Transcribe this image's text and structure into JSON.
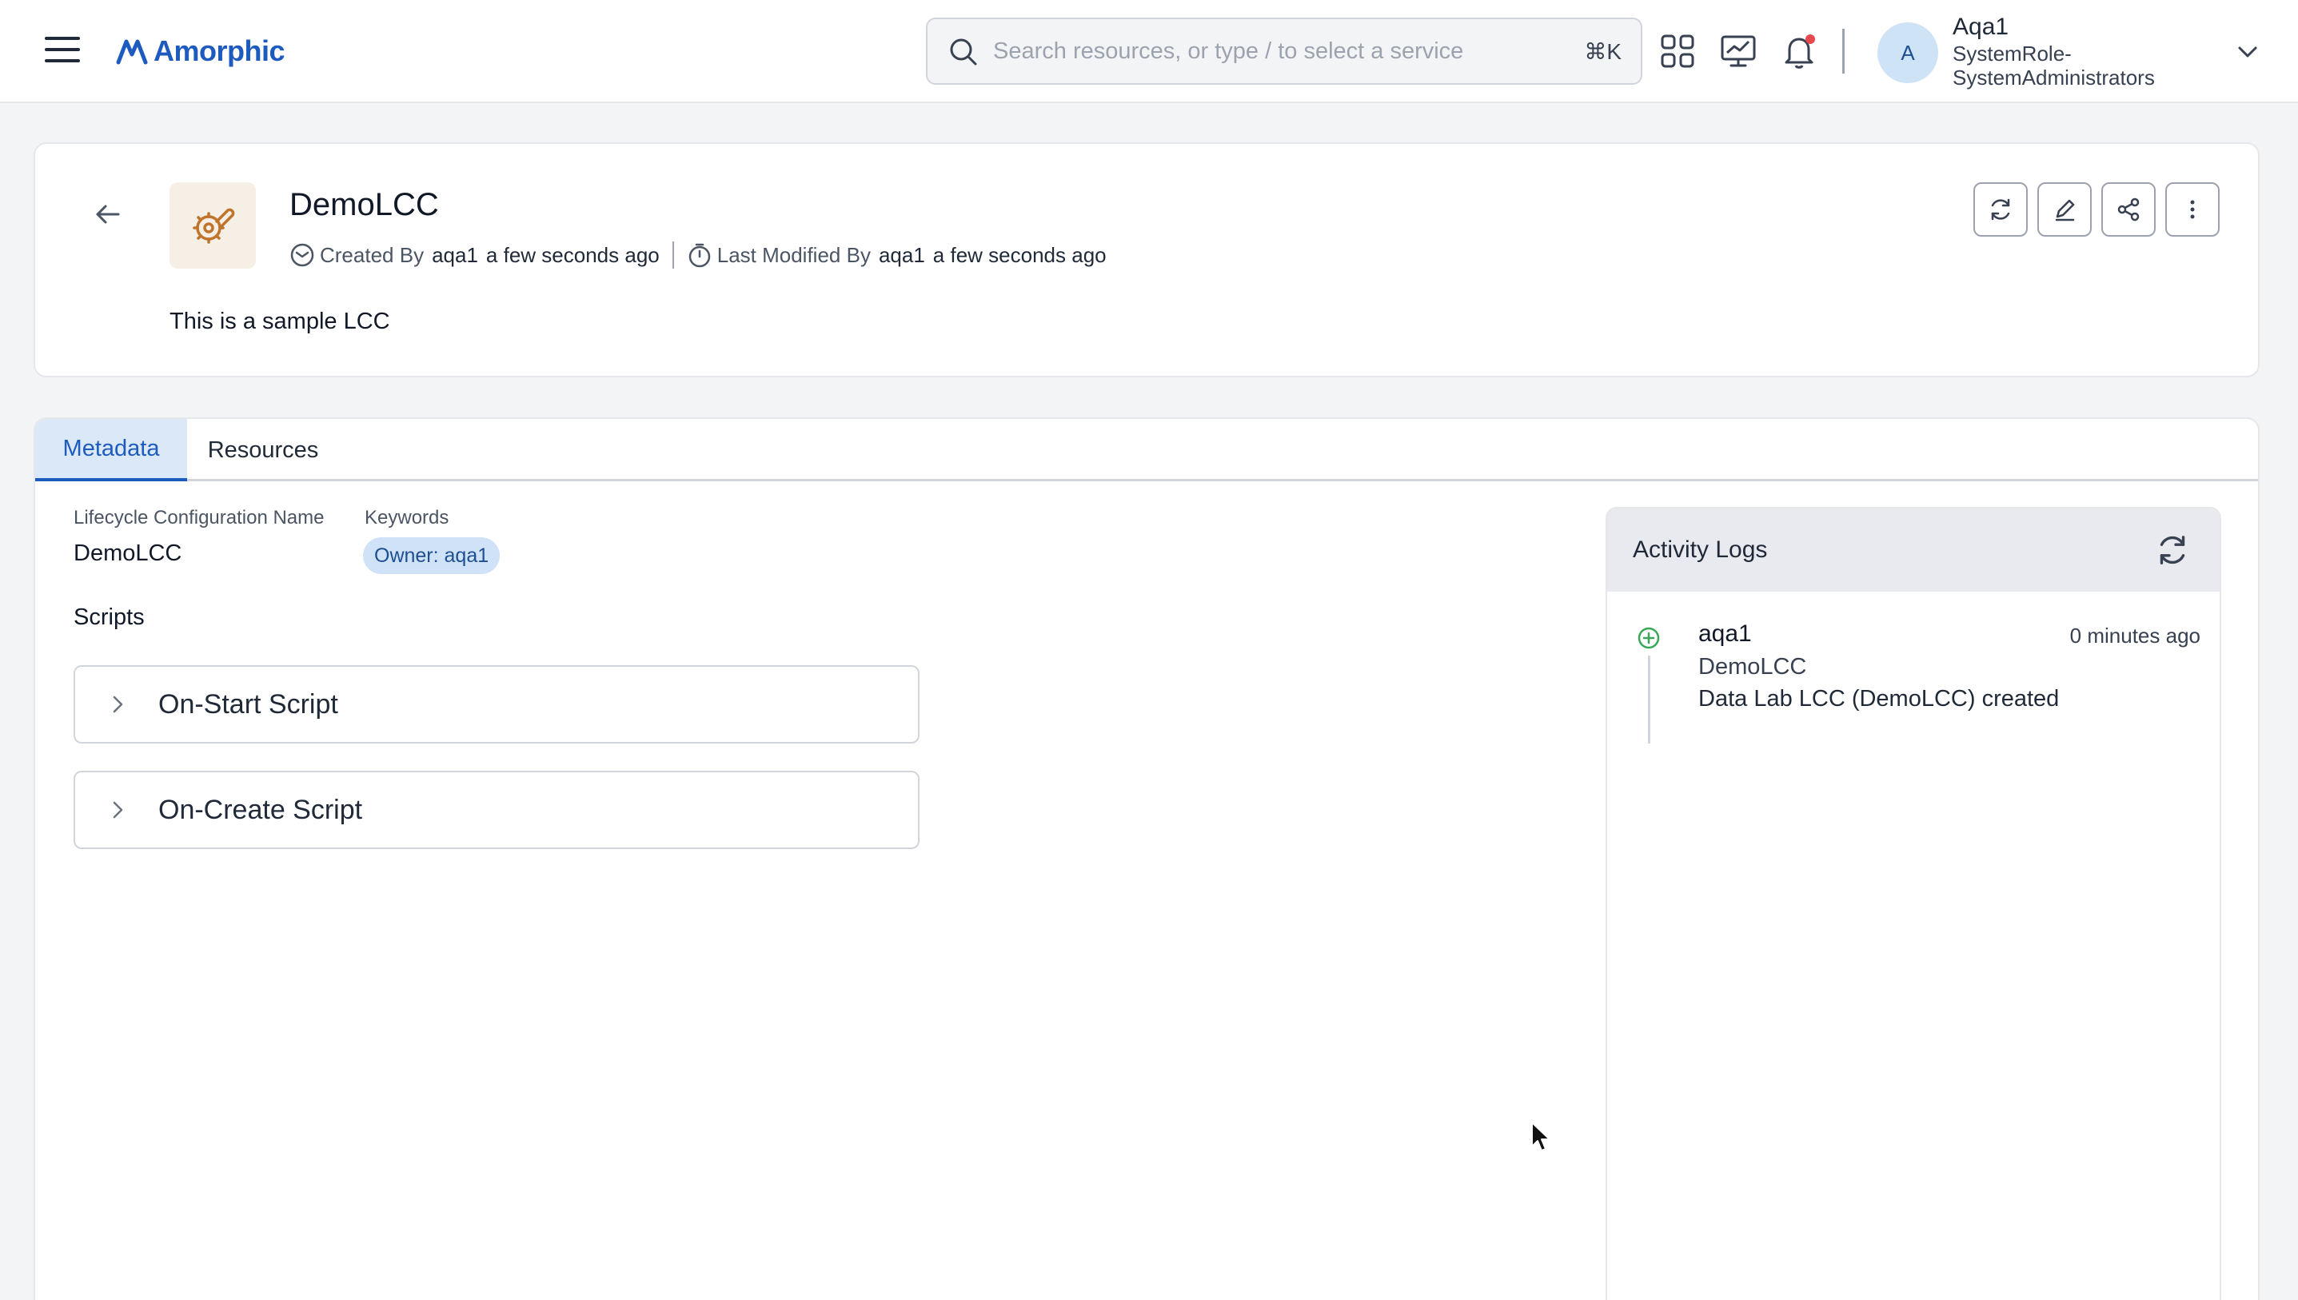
{
  "topbar": {
    "brand": "Amorphic",
    "search_placeholder": "Search resources, or type / to select a service",
    "search_shortcut": "⌘K",
    "icons": [
      "menu-icon",
      "apps-grid-icon",
      "monitor-chart-icon",
      "bell-icon"
    ],
    "notification_dot_color": "#e5484d",
    "avatar_initial": "A",
    "user_name": "Aqa1",
    "user_role_line1": "SystemRole-",
    "user_role_line2": "SystemAdministrators"
  },
  "header": {
    "title": "DemoLCC",
    "created_by_label": "Created By",
    "created_by_user": "aqa1",
    "created_time": "a few seconds ago",
    "modified_by_label": "Last Modified By",
    "modified_by_user": "aqa1",
    "modified_time": "a few seconds ago",
    "description": "This is a sample LCC",
    "actions": [
      "refresh-icon",
      "edit-icon",
      "share-icon",
      "more-vertical-icon"
    ],
    "icon_color": "#c0732a"
  },
  "tabs": [
    {
      "label": "Metadata",
      "active": true
    },
    {
      "label": "Resources",
      "active": false
    }
  ],
  "metadata": {
    "name_label": "Lifecycle Configuration Name",
    "name_value": "DemoLCC",
    "keywords_label": "Keywords",
    "keywords": [
      "Owner: aqa1"
    ],
    "scripts_label": "Scripts",
    "scripts": [
      "On-Start Script",
      "On-Create Script"
    ]
  },
  "activity": {
    "title": "Activity Logs",
    "logs": [
      {
        "user": "aqa1",
        "time": "0 minutes ago",
        "entity": "DemoLCC",
        "message": "Data Lab LCC (DemoLCC) created"
      }
    ],
    "created_color": "#3aa757"
  },
  "colors": {
    "accent": "#1d5bbf",
    "page_bg": "#f3f4f6",
    "chip_bg": "#cfe2f7"
  }
}
